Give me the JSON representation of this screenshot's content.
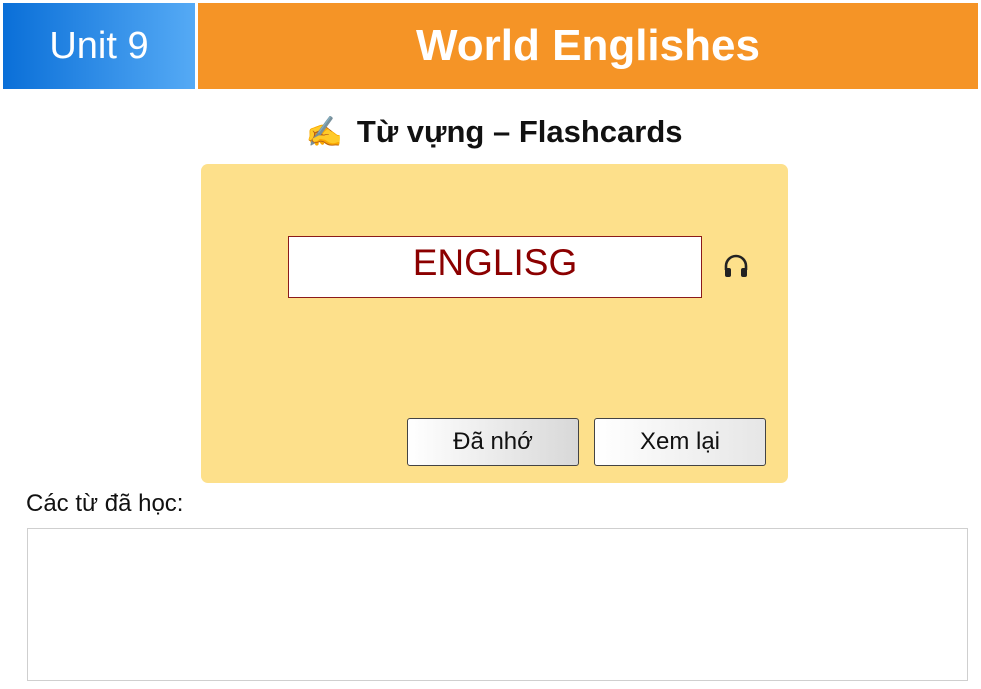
{
  "header": {
    "unit_label": "Unit 9",
    "unit_title": "World Englishes"
  },
  "section": {
    "icon": "writing-hand-emoji",
    "icon_glyph": "✍️",
    "title": "Từ vựng – Flashcards"
  },
  "flashcard": {
    "word": "ENGLISG",
    "audio_icon": "headphones-icon",
    "remember_label": "Đã nhớ",
    "review_label": "Xem lại"
  },
  "learned": {
    "label": "Các từ đã học:",
    "items": []
  },
  "colors": {
    "unit_badge_start": "#0a6fd8",
    "unit_badge_end": "#55aaf5",
    "title_bar": "#f59426",
    "card_bg": "#fde08b",
    "word_text": "#8b0000"
  }
}
